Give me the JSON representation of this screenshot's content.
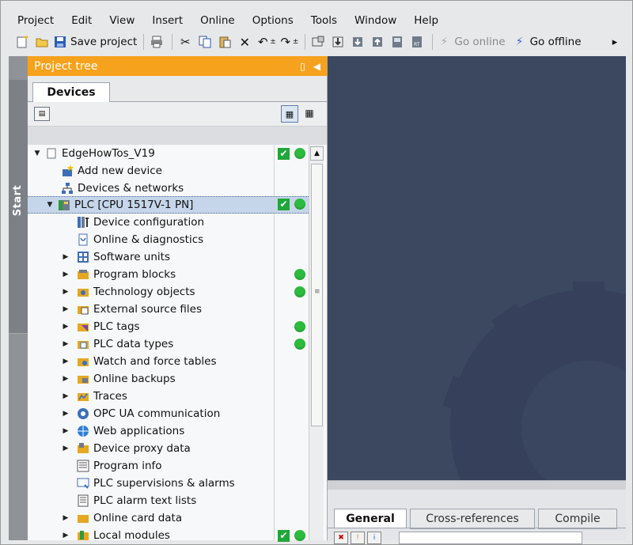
{
  "menu": [
    "Project",
    "Edit",
    "View",
    "Insert",
    "Online",
    "Options",
    "Tools",
    "Window",
    "Help"
  ],
  "toolbar": {
    "save_label": "Save project",
    "go_online_label": "Go online",
    "go_offline_label": "Go offline"
  },
  "start_label": "Start",
  "project_tree": {
    "title": "Project tree",
    "tab_label": "Devices"
  },
  "tree": [
    {
      "label": "EdgeHowTos_V19",
      "icon": "project-icon"
    },
    {
      "label": "Add new device",
      "icon": "add-device-icon"
    },
    {
      "label": "Devices & networks",
      "icon": "network-icon"
    },
    {
      "label": "PLC [CPU 1517V-1 PN]",
      "icon": "plc-icon"
    },
    {
      "label": "Device configuration",
      "icon": "device-config-icon"
    },
    {
      "label": "Online & diagnostics",
      "icon": "diagnostics-icon"
    },
    {
      "label": "Software units",
      "icon": "software-units-icon"
    },
    {
      "label": "Program blocks",
      "icon": "program-blocks-icon"
    },
    {
      "label": "Technology objects",
      "icon": "technology-objects-icon"
    },
    {
      "label": "External source files",
      "icon": "source-files-icon"
    },
    {
      "label": "PLC tags",
      "icon": "plc-tags-icon"
    },
    {
      "label": "PLC data types",
      "icon": "data-types-icon"
    },
    {
      "label": "Watch and force tables",
      "icon": "watch-tables-icon"
    },
    {
      "label": "Online backups",
      "icon": "backups-icon"
    },
    {
      "label": "Traces",
      "icon": "traces-icon"
    },
    {
      "label": "OPC UA communication",
      "icon": "opc-ua-icon"
    },
    {
      "label": "Web applications",
      "icon": "web-apps-icon"
    },
    {
      "label": "Device proxy data",
      "icon": "proxy-data-icon"
    },
    {
      "label": "Program info",
      "icon": "program-info-icon"
    },
    {
      "label": "PLC supervisions & alarms",
      "icon": "alarms-icon"
    },
    {
      "label": "PLC alarm text lists",
      "icon": "text-lists-icon"
    },
    {
      "label": "Online card data",
      "icon": "card-data-icon"
    },
    {
      "label": "Local modules",
      "icon": "local-modules-icon"
    }
  ],
  "inspector": {
    "tabs": [
      "General",
      "Cross-references",
      "Compile"
    ]
  },
  "colors": {
    "accent": "#f7a21d",
    "status_ok": "#2dbb3e",
    "selection": "#c6d6ea",
    "workspace_bg": "#3c4760"
  }
}
